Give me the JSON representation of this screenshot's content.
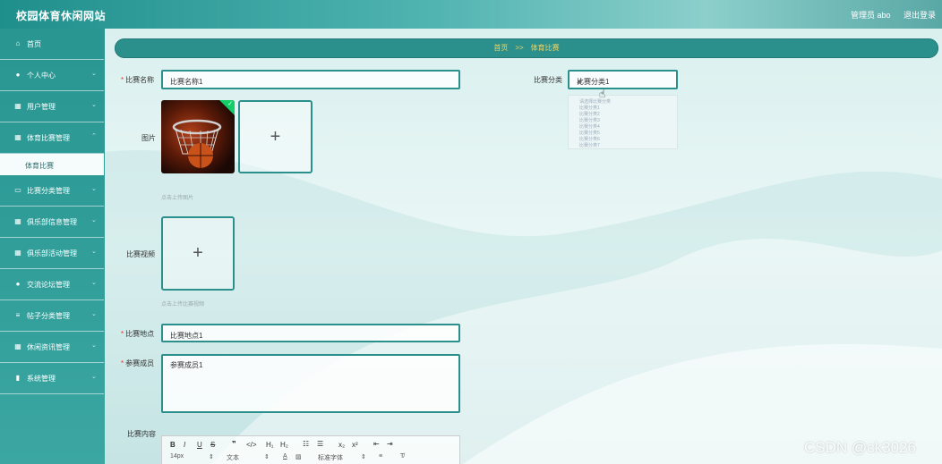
{
  "header": {
    "site_title": "校园体育休闲网站",
    "admin_label": "管理员 abo",
    "logout_label": "退出登录"
  },
  "sidebar": {
    "items": [
      {
        "icon": "home-icon",
        "label": "首页"
      },
      {
        "icon": "user-icon",
        "label": "个人中心"
      },
      {
        "icon": "grid-icon",
        "label": "用户管理"
      },
      {
        "icon": "grid-icon",
        "label": "体育比赛管理"
      },
      {
        "icon": "monitor-icon",
        "label": "比赛分类管理"
      },
      {
        "icon": "grid-icon",
        "label": "俱乐部信息管理"
      },
      {
        "icon": "grid-icon",
        "label": "俱乐部活动管理"
      },
      {
        "icon": "user-icon",
        "label": "交流论坛管理"
      },
      {
        "icon": "list-icon",
        "label": "帖子分类管理"
      },
      {
        "icon": "table-icon",
        "label": "休闲资讯管理"
      },
      {
        "icon": "chart-icon",
        "label": "系统管理"
      }
    ],
    "sub_item": "体育比赛"
  },
  "breadcrumb": {
    "home": "首页",
    "separator": ">>",
    "current": "体育比赛"
  },
  "form": {
    "name_label": "比赛名称",
    "name_value": "比赛名称1",
    "category_label": "比赛分类",
    "category_value": "比赛分类1",
    "image_label": "图片",
    "image_hint": "点击上传图片",
    "video_label": "比赛视频",
    "video_hint": "点击上传比赛视频",
    "location_label": "比赛地点",
    "location_value": "比赛地点1",
    "members_label": "参赛成员",
    "members_value": "参赛成员1",
    "content_label": "比赛内容"
  },
  "dropdown_options": [
    "请选择比赛分类",
    "比赛分类1",
    "比赛分类2",
    "比赛分类3",
    "比赛分类4",
    "比赛分类5",
    "比赛分类6",
    "比赛分类7"
  ],
  "editor": {
    "font_size": "14px",
    "text_type": "文本",
    "font_family": "标准字体"
  },
  "watermark": "CSDN @ck3026"
}
